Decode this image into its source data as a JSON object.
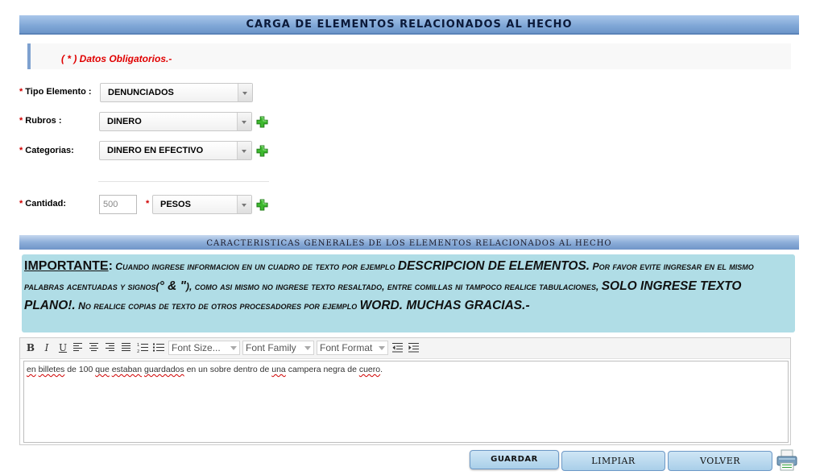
{
  "header": {
    "title": "CARGA DE ELEMENTOS RELACIONADOS AL HECHO"
  },
  "notice": {
    "text": "( * ) Datos Obligatorios.-"
  },
  "form": {
    "required_mark": "*",
    "tipo_elemento": {
      "label": "Tipo Elemento :",
      "value": "DENUNCIADOS"
    },
    "rubros": {
      "label": "Rubros :",
      "value": "DINERO"
    },
    "categorias": {
      "label": "Categorias:",
      "value": "DINERO EN EFECTIVO"
    },
    "cantidad": {
      "label": "Cantidad:",
      "value": "500"
    },
    "moneda": {
      "value": "PESOS"
    }
  },
  "section": {
    "title": "CARACTERISTICAS GENERALES DE LOS ELEMENTOS RELACIONADOS AL HECHO"
  },
  "important": {
    "title": "IMPORTANTE",
    "colon": ":",
    "part1": " Cuando ingrese informacion en un cuadro de texto por ejemplo ",
    "big1": "DESCRIPCION DE ELEMENTOS.",
    "part2": " Por favor evite ingresar en el mismo palabras acentuadas y signos(",
    "big2": "° & \"",
    "part3": "), como asi mismo no ingrese texto resaltado, entre comillas ni tampoco realice tabulaciones, ",
    "big3": "SOLO INGRESE TEXTO PLANO!.",
    "part4": " No realice copias de texto de otros procesadores por ejemplo ",
    "big4": "WORD. MUCHAS GRACIAS.-"
  },
  "editor": {
    "toolbar": {
      "bold": "B",
      "italic": "I",
      "underline": "U",
      "font_size": "Font Size...",
      "font_family": "Font Family",
      "font_format": "Font Format"
    },
    "content": {
      "w1": "en",
      "w2": "billetes",
      "w3": "de 100",
      "w4": "que",
      "w5": "estaban",
      "w6": "guardados",
      "w7": "en un sobre dentro de",
      "w8": "una",
      "w9": "campera negra de",
      "w10": "cuero",
      "w11": "."
    }
  },
  "buttons": {
    "guardar": "GUARDAR",
    "limpiar": "LIMPIAR",
    "volver": "VOLVER"
  },
  "colors": {
    "header_blue": "#7fa6d6",
    "important_bg": "#b0dde6",
    "required_red": "#d00000",
    "plus_green": "#3db82e"
  }
}
